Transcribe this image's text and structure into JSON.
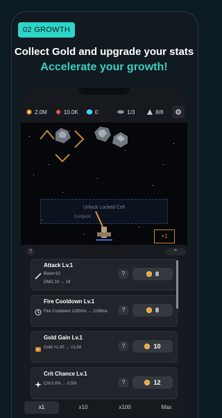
{
  "promo": {
    "badge": "02 GROWTH",
    "headline": "Collect Gold and upgrade your stats",
    "subheadline": "Accelerate your growth!"
  },
  "colors": {
    "accent": "#2dd6c8",
    "gold": "#e8a62b",
    "background": "#0c1a22"
  },
  "resources": {
    "gold": "2.0M",
    "ruby": "10.0K",
    "gem": "0",
    "ships": "1/3",
    "units": "8/8"
  },
  "battlefield": {
    "locked_cell_label": "Unlock Locked Cell",
    "dungeon_label": "Dungeon",
    "speed_multiplier": "×1"
  },
  "help_label": "?",
  "collapse_label": "^",
  "upgrades": [
    {
      "title": "Attack Lv.1",
      "desc1": "Base+10",
      "desc2": "DMG 10 → 19",
      "help": "?",
      "cost": "8",
      "icon": "sword-icon"
    },
    {
      "title": "Fire Cooldown Lv.1",
      "desc1": "Fire Cooldown 1200ms → 1196ms",
      "help": "?",
      "cost": "8",
      "icon": "clock-icon"
    },
    {
      "title": "Gold Gain Lv.1",
      "desc1": "Gold ×1.00 → ×1.04",
      "help": "?",
      "cost": "10",
      "icon": "gold-bag-icon"
    },
    {
      "title": "Crit Chance Lv.1",
      "desc1": "Crit 0.0% → 0.5%",
      "help": "?",
      "cost": "12",
      "icon": "sparkle-icon"
    }
  ],
  "tabs": [
    {
      "label": "x1",
      "active": true
    },
    {
      "label": "x10",
      "active": false
    },
    {
      "label": "x100",
      "active": false
    },
    {
      "label": "Max",
      "active": false
    }
  ]
}
